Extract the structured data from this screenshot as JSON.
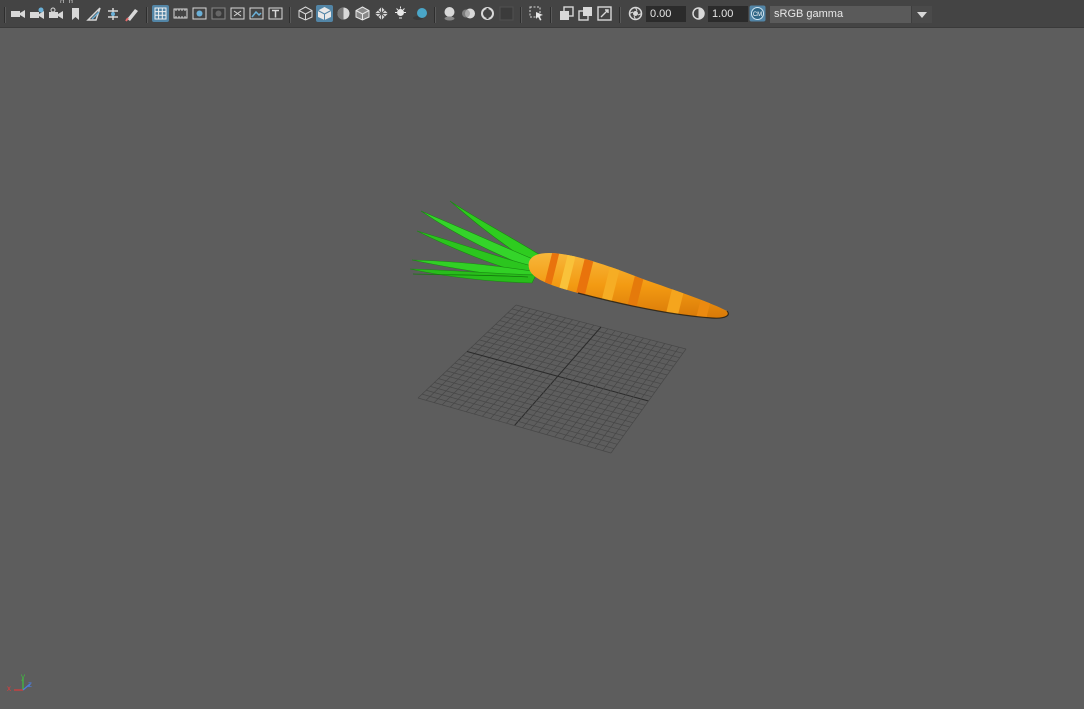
{
  "toolbar": {
    "menu_remnant": "g g",
    "exposure_value": "0.00",
    "gamma_value": "1.00",
    "color_space": "sRGB gamma",
    "cm_badge": "CM"
  },
  "icons": [
    "select-camera-icon",
    "camera-attributes-icon",
    "bookmarks-icon",
    "image-plane-icon",
    "2d-pan-zoom-icon",
    "grease-pencil-icon",
    "grid-icon",
    "film-gate-icon",
    "resolution-gate-icon",
    "gate-mask-icon",
    "field-chart-icon",
    "safe-action-icon",
    "safe-title-icon",
    "wireframe-icon",
    "smooth-shade-all-icon",
    "use-default-material-icon",
    "wireframe-on-shaded-icon",
    "textured-icon",
    "use-all-lights-icon",
    "shadows-icon",
    "screen-space-ao-icon",
    "motion-blur-icon",
    "anti-aliasing-icon",
    "depth-of-field-icon",
    "isolate-select-icon",
    "xray-icon",
    "xray-active-components-icon",
    "xray-joints-icon",
    "exposure-icon",
    "gamma-icon",
    "color-management-icon"
  ],
  "axis": {
    "x": "x",
    "y": "y",
    "z": "z"
  },
  "colors": {
    "viewport_bg": "#5d5d5d",
    "toolbar_bg": "#444444",
    "active_button": "#5285a6",
    "carrot_orange": "#f39a12",
    "carrot_stripe": "#e9730c",
    "leaf_green": "#2ecc1f"
  }
}
